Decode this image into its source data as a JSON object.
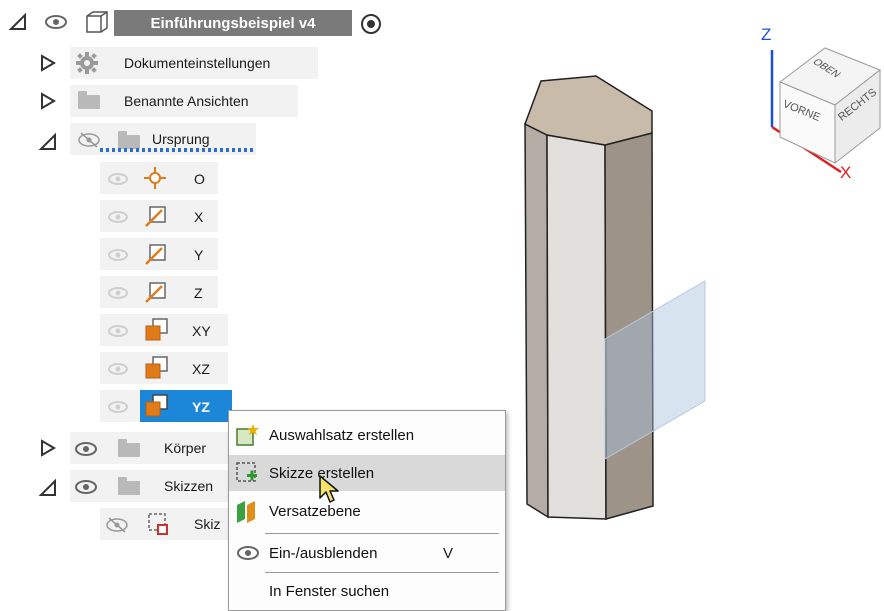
{
  "browser": {
    "root": {
      "label": "Einführungsbeispiel v4"
    },
    "items": [
      {
        "label": "Dokumenteinstellungen"
      },
      {
        "label": "Benannte Ansichten"
      },
      {
        "label": "Ursprung"
      }
    ],
    "origin": [
      {
        "label": "O"
      },
      {
        "label": "X"
      },
      {
        "label": "Y"
      },
      {
        "label": "Z"
      },
      {
        "label": "XY"
      },
      {
        "label": "XZ"
      },
      {
        "label": "YZ"
      }
    ],
    "koerper": {
      "label": "Körper"
    },
    "skizzen": {
      "label": "Skizzen"
    },
    "skizze_child": {
      "label": "Skiz"
    }
  },
  "context_menu": {
    "items": [
      {
        "label": "Auswahlsatz erstellen"
      },
      {
        "label": "Skizze erstellen"
      },
      {
        "label": "Versatzebene"
      },
      {
        "label": "Ein-/ausblenden",
        "shortcut": "V"
      },
      {
        "label": "In Fenster suchen"
      }
    ]
  },
  "viewcube": {
    "axis_z": "Z",
    "axis_x": "X",
    "face_top": "OBEN",
    "face_front": "VORNE",
    "face_right": "RECHTS"
  },
  "colors": {
    "selection": "#1c86d8",
    "accent_orange": "#e07b1a",
    "axis_z": "#1a4fd8",
    "axis_x": "#e02020"
  }
}
